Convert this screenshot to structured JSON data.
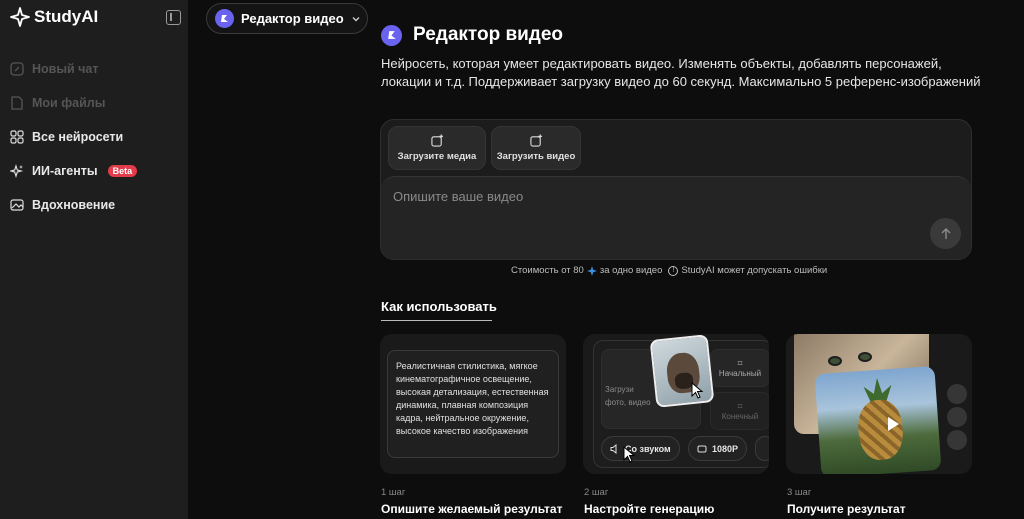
{
  "app": {
    "name": "StudyAI"
  },
  "sidebar": {
    "items": [
      {
        "label": "Новый чат",
        "icon": "edit-icon"
      },
      {
        "label": "Мои файлы",
        "icon": "file-icon"
      },
      {
        "label": "Все нейросети",
        "icon": "grid-icon"
      },
      {
        "label": "ИИ-агенты",
        "icon": "sparkle-icon",
        "badge": "Beta"
      },
      {
        "label": "Вдохновение",
        "icon": "image-icon"
      }
    ]
  },
  "model_selector": {
    "label": "Редактор видео"
  },
  "header": {
    "title": "Редактор видео",
    "description": "Нейросеть, которая умеет редактировать видео. Изменять объекты, добавлять персонажей, локации и т.д. Поддерживает загрузку видео до 60 секунд. Максимально 5 референс-изображений"
  },
  "prompt": {
    "upload_media": "Загрузите медиа",
    "upload_video": "Загрузить видео",
    "placeholder": "Опишите ваше видео",
    "cost_prefix": "Стоимость от 80",
    "cost_suffix": "за одно видео",
    "disclaimer": "StudyAI может допускать ошибки"
  },
  "howto": {
    "title": "Как использовать",
    "steps": [
      {
        "n": "1 шаг",
        "title": "Опишите желаемый результат"
      },
      {
        "n": "2 шаг",
        "title": "Настройте генерацию"
      },
      {
        "n": "3 шаг",
        "title": "Получите результат"
      }
    ],
    "card1_text": "Реалистичная стилистика, мягкое кинематографичное освещение, высокая детализация, естественная динамика, плавная композиция кадра, нейтральное окружение, высокое качество изображения",
    "card2": {
      "upload_line1": "Загрузи",
      "upload_line2": "фото, видео",
      "start_frame": "Начальный",
      "end_frame": "Конечный",
      "sound": "Со звуком",
      "resolution": "1080P"
    }
  },
  "colors": {
    "accent": "#6a63f0",
    "badge": "#e23b4a",
    "background": "#0d0d0d",
    "sidebar": "#1e1e1e"
  }
}
